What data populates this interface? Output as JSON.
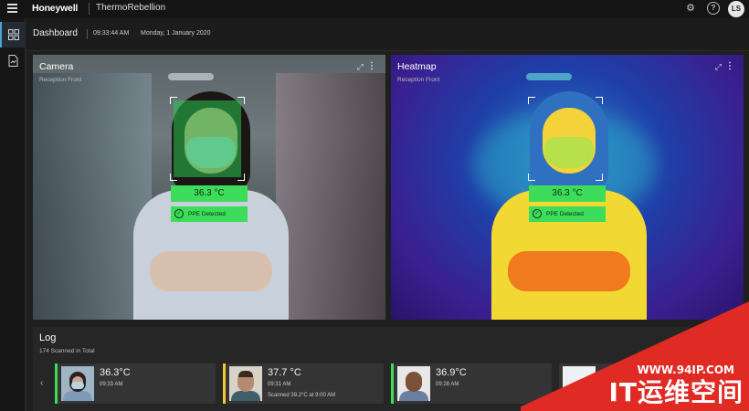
{
  "app": {
    "brand": "Honeywell",
    "name": "ThermoRebellion",
    "user_initials": "LS"
  },
  "header": {
    "title": "Dashboard",
    "time": "09:33:44 AM",
    "date": "Monday, 1 January 2020"
  },
  "icons": {
    "menu": "hamburger-icon",
    "settings": "gear-icon",
    "help": "question-icon",
    "rail": [
      "dashboard-grid-icon",
      "report-document-icon"
    ],
    "panel_expand": "expand-icon",
    "panel_more": "more-vertical-icon",
    "log_prev": "chevron-left-icon"
  },
  "colors": {
    "ok": "#3ddc5a",
    "warning": "#f2c82e",
    "accent": "#4aa3df"
  },
  "camera": {
    "title": "Camera",
    "location": "Reception Front",
    "temperature": "36.3 °C",
    "ppe": "PPE Detected"
  },
  "heatmap": {
    "title": "Heatmap",
    "location": "Reception Front",
    "temperature": "36.3 °C",
    "ppe": "PPE Detected"
  },
  "log": {
    "title": "Log",
    "summary": "174 Scanned in Total",
    "entries": [
      {
        "temp": "36.3°C",
        "time": "09:33 AM",
        "note": "",
        "status": "ok"
      },
      {
        "temp": "37.7 °C",
        "time": "09:31 AM",
        "note": "Scanned 39.2°C at 9:00 AM",
        "status": "warning"
      },
      {
        "temp": "36.9°C",
        "time": "09:28 AM",
        "note": "",
        "status": "ok"
      },
      {
        "temp": "",
        "time": "",
        "note": "",
        "status": "ok"
      }
    ]
  },
  "watermark": {
    "url": "WWW.94IP.COM",
    "text": "IT运维空间"
  }
}
